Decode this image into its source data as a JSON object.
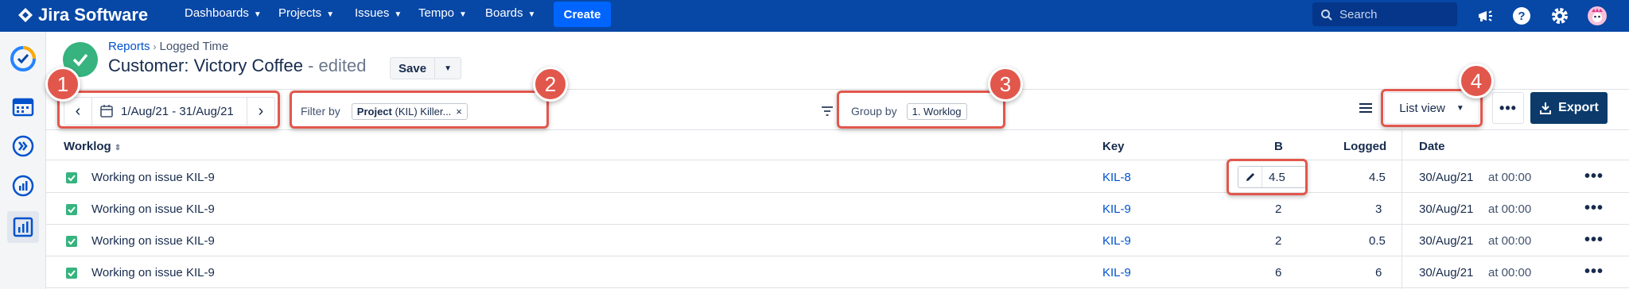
{
  "topnav": {
    "logo": "Jira Software",
    "items": [
      {
        "label": "Dashboards"
      },
      {
        "label": "Projects"
      },
      {
        "label": "Issues"
      },
      {
        "label": "Tempo"
      },
      {
        "label": "Boards"
      }
    ],
    "create_label": "Create",
    "search_placeholder": "Search"
  },
  "header": {
    "breadcrumb": {
      "root": "Reports",
      "current": "Logged Time"
    },
    "title": "Customer: Victory Coffee",
    "edited": " - edited",
    "save_label": "Save"
  },
  "toolbar": {
    "date_range": "1/Aug/21 - 31/Aug/21",
    "filter_label": "Filter by",
    "filter_chip_bold": "Project",
    "filter_chip_text": "(KIL) Killer...",
    "group_label": "Group by",
    "group_chip": "1. Worklog",
    "view_label": "List view",
    "more_label": "•••",
    "export_label": "Export"
  },
  "callouts": [
    "1",
    "2",
    "3",
    "4"
  ],
  "table": {
    "columns": {
      "worklog": "Worklog",
      "key": "Key",
      "b": "B",
      "logged": "Logged",
      "date": "Date"
    },
    "rows": [
      {
        "description": "Working on issue KIL-9",
        "key": "KIL-8",
        "b": "4.5",
        "logged": "4.5",
        "date": "30/Aug/21",
        "time": "at 00:00",
        "actions": "•••"
      },
      {
        "description": "Working on issue KIL-9",
        "key": "KIL-9",
        "b": "2",
        "logged": "3",
        "date": "30/Aug/21",
        "time": "at 00:00",
        "actions": "•••"
      },
      {
        "description": "Working on issue KIL-9",
        "key": "KIL-9",
        "b": "2",
        "logged": "0.5",
        "date": "30/Aug/21",
        "time": "at 00:00",
        "actions": "•••"
      },
      {
        "description": "Working on issue KIL-9",
        "key": "KIL-9",
        "b": "6",
        "logged": "6",
        "date": "30/Aug/21",
        "time": "at 00:00",
        "actions": "•••"
      }
    ]
  },
  "colors": {
    "nav": "#0747A6",
    "accent": "#0052CC",
    "success": "#36B37E",
    "callout": "#E2574C",
    "export": "#0B3A6B"
  }
}
